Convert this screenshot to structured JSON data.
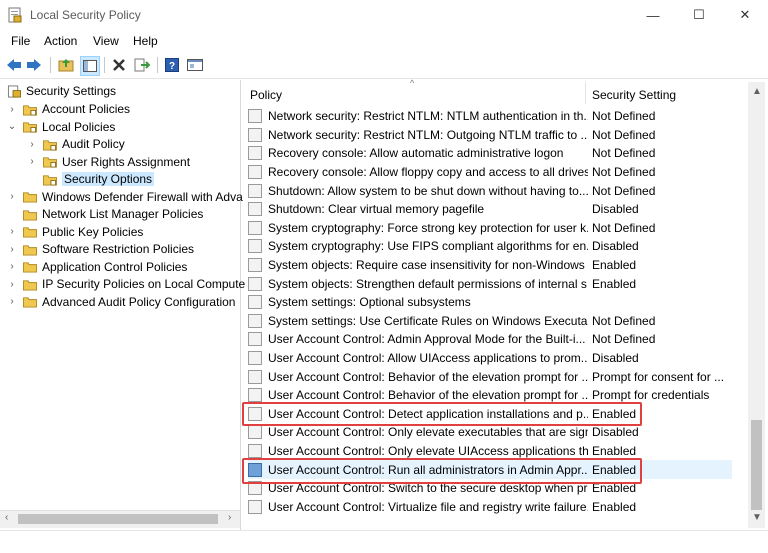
{
  "window": {
    "title": "Local Security Policy",
    "controls": [
      "—",
      "☐",
      "✕"
    ]
  },
  "menu": [
    "File",
    "Action",
    "View",
    "Help"
  ],
  "toolbar_icons": [
    "back-icon",
    "forward-icon",
    "up-folder-icon",
    "show-hide-tree-icon",
    "delete-icon",
    "export-list-icon",
    "help-icon",
    "properties-icon"
  ],
  "tree": {
    "root": "Security Settings",
    "items": [
      {
        "label": "Account Policies",
        "level": 1,
        "expander": "›"
      },
      {
        "label": "Local Policies",
        "level": 1,
        "expander": "⌄"
      },
      {
        "label": "Audit Policy",
        "level": 2,
        "expander": "›"
      },
      {
        "label": "User Rights Assignment",
        "level": 2,
        "expander": "›"
      },
      {
        "label": "Security Options",
        "level": 2,
        "expander": ""
      },
      {
        "label": "Windows Defender Firewall with Adva",
        "level": 1,
        "expander": "›"
      },
      {
        "label": "Network List Manager Policies",
        "level": 1,
        "expander": ""
      },
      {
        "label": "Public Key Policies",
        "level": 1,
        "expander": "›"
      },
      {
        "label": "Software Restriction Policies",
        "level": 1,
        "expander": "›"
      },
      {
        "label": "Application Control Policies",
        "level": 1,
        "expander": "›"
      },
      {
        "label": "IP Security Policies on Local Compute",
        "level": 1,
        "expander": "›"
      },
      {
        "label": "Advanced Audit Policy Configuration",
        "level": 1,
        "expander": "›"
      }
    ]
  },
  "list": {
    "headers": {
      "policy": "Policy",
      "setting": "Security Setting"
    },
    "rows": [
      {
        "policy": "Network security: Restrict NTLM: NTLM authentication in th...",
        "setting": "Not Defined"
      },
      {
        "policy": "Network security: Restrict NTLM: Outgoing NTLM traffic to ...",
        "setting": "Not Defined"
      },
      {
        "policy": "Recovery console: Allow automatic administrative logon",
        "setting": "Not Defined"
      },
      {
        "policy": "Recovery console: Allow floppy copy and access to all drives...",
        "setting": "Not Defined"
      },
      {
        "policy": "Shutdown: Allow system to be shut down without having to...",
        "setting": "Not Defined"
      },
      {
        "policy": "Shutdown: Clear virtual memory pagefile",
        "setting": "Disabled"
      },
      {
        "policy": "System cryptography: Force strong key protection for user k...",
        "setting": "Not Defined"
      },
      {
        "policy": "System cryptography: Use FIPS compliant algorithms for en...",
        "setting": "Disabled"
      },
      {
        "policy": "System objects: Require case insensitivity for non-Windows ...",
        "setting": "Enabled"
      },
      {
        "policy": "System objects: Strengthen default permissions of internal s...",
        "setting": "Enabled"
      },
      {
        "policy": "System settings: Optional subsystems",
        "setting": ""
      },
      {
        "policy": "System settings: Use Certificate Rules on Windows Executabl...",
        "setting": "Not Defined"
      },
      {
        "policy": "User Account Control: Admin Approval Mode for the Built-i...",
        "setting": "Not Defined"
      },
      {
        "policy": "User Account Control: Allow UIAccess applications to prom...",
        "setting": "Disabled"
      },
      {
        "policy": "User Account Control: Behavior of the elevation prompt for ...",
        "setting": "Prompt for consent for ..."
      },
      {
        "policy": "User Account Control: Behavior of the elevation prompt for ...",
        "setting": "Prompt for credentials"
      },
      {
        "policy": "User Account Control: Detect application installations and p...",
        "setting": "Enabled"
      },
      {
        "policy": "User Account Control: Only elevate executables that are sign...",
        "setting": "Disabled"
      },
      {
        "policy": "User Account Control: Only elevate UIAccess applications th...",
        "setting": "Enabled"
      },
      {
        "policy": "User Account Control: Run all administrators in Admin Appr...",
        "setting": "Enabled"
      },
      {
        "policy": "User Account Control: Switch to the secure desktop when pr...",
        "setting": "Enabled"
      },
      {
        "policy": "User Account Control: Virtualize file and registry write failure...",
        "setting": "Enabled"
      }
    ]
  },
  "colors": {
    "selection": "#e5f3ff",
    "tree_selection": "#cce8ff",
    "highlight_box": "#e04040"
  }
}
